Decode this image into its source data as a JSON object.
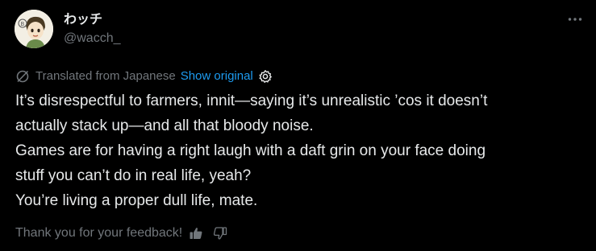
{
  "author": {
    "display_name": "わッチ",
    "handle": "@wacch_"
  },
  "translation": {
    "label": "Translated from Japanese",
    "show_original": "Show original"
  },
  "tweet": {
    "lines": [
      "It’s disrespectful to farmers, innit—saying it’s unrealistic ’cos it doesn’t",
      "actually stack up—and all that bloody noise.",
      "Games are for having a right laugh with a daft grin on your face doing",
      "stuff you can’t do in real life, yeah?",
      "You’re living a proper dull life, mate."
    ]
  },
  "feedback": {
    "label": "Thank you for your feedback!"
  },
  "icons": {
    "more": "more-horizontal-icon",
    "translate": "translate-slash-icon",
    "gear": "gear-icon",
    "thumbs_up": "thumbs-up-icon",
    "thumbs_down": "thumbs-down-icon"
  },
  "colors": {
    "background": "#000000",
    "text": "#e7e9ea",
    "secondary": "#71767b",
    "link": "#1d9bf0"
  }
}
